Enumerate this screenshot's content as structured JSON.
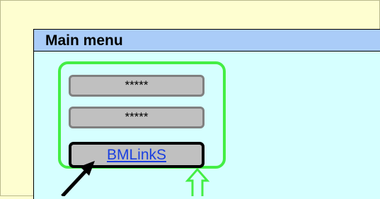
{
  "menu": {
    "title": "Main menu",
    "password_field_1": "*****",
    "password_field_2": "*****",
    "link_button": "BMLinkS"
  },
  "colors": {
    "page_background": "#fefed0",
    "window_background": "#d6ffff",
    "header_background": "#aaccf8",
    "group_highlight": "#44ee44",
    "field_background": "#c0c0c0",
    "link_text": "#1a3fe0"
  },
  "icons": [
    "black-arrow-icon",
    "green-arrow-icon"
  ]
}
